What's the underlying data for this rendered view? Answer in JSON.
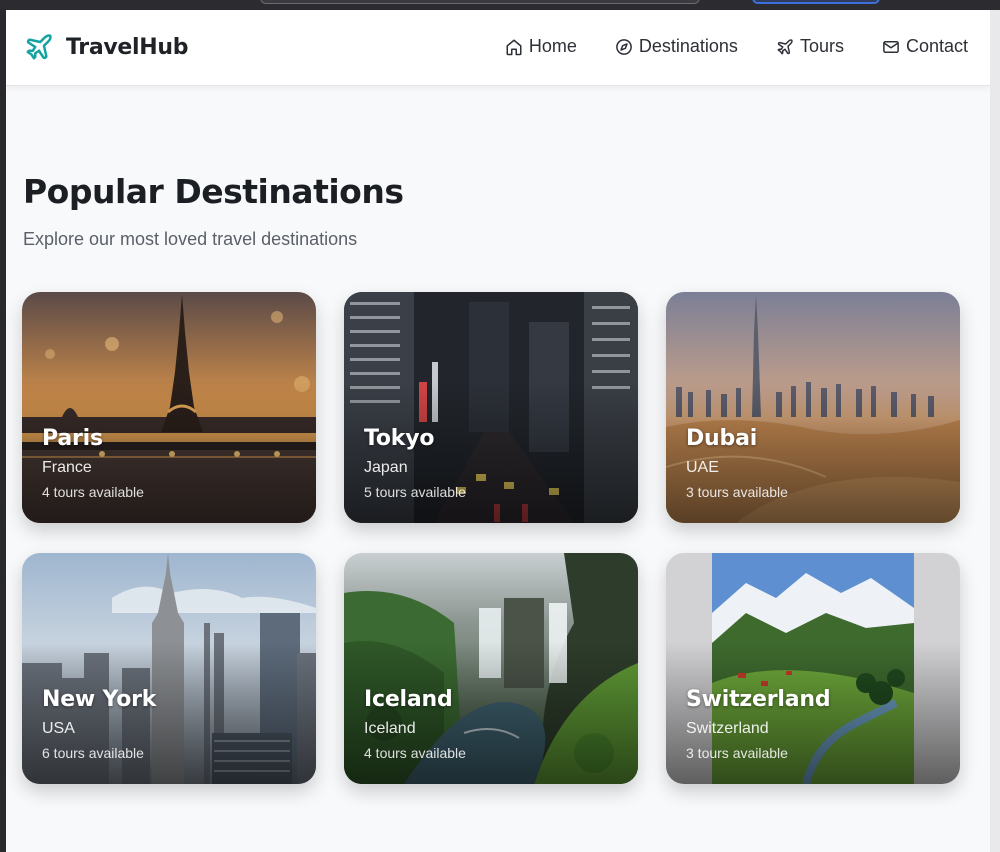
{
  "brand": {
    "name": "TravelHub",
    "icon": "plane-icon",
    "accent": "#14a3a3"
  },
  "nav": [
    {
      "label": "Home",
      "icon": "home-icon"
    },
    {
      "label": "Destinations",
      "icon": "compass-icon"
    },
    {
      "label": "Tours",
      "icon": "plane-icon"
    },
    {
      "label": "Contact",
      "icon": "mail-icon"
    }
  ],
  "section": {
    "title": "Popular Destinations",
    "subtitle": "Explore our most loved travel destinations"
  },
  "destinations": [
    {
      "city": "Paris",
      "country": "France",
      "tours": "4 tours available"
    },
    {
      "city": "Tokyo",
      "country": "Japan",
      "tours": "5 tours available"
    },
    {
      "city": "Dubai",
      "country": "UAE",
      "tours": "3 tours available"
    },
    {
      "city": "New York",
      "country": "USA",
      "tours": "6 tours available"
    },
    {
      "city": "Iceland",
      "country": "Iceland",
      "tours": "4 tours available"
    },
    {
      "city": "Switzerland",
      "country": "Switzerland",
      "tours": "3 tours available"
    }
  ]
}
